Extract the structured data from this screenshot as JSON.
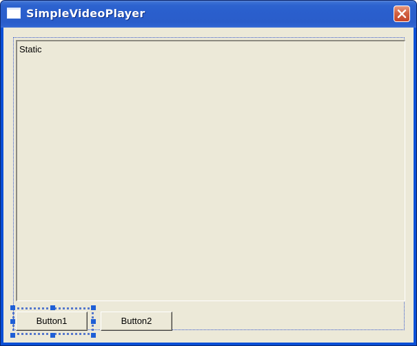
{
  "window": {
    "title": "SimpleVideoPlayer",
    "icon": "app-window-icon",
    "close_icon": "close-icon"
  },
  "dialog": {
    "static_text": "Static",
    "buttons": [
      {
        "label": "Button1",
        "selected": true
      },
      {
        "label": "Button2",
        "selected": false
      }
    ]
  },
  "colors": {
    "titlebar": "#2a5fcd",
    "client_bg": "#ece9d8",
    "selection_handle": "#1f5fd6",
    "close_button": "#d26242"
  }
}
